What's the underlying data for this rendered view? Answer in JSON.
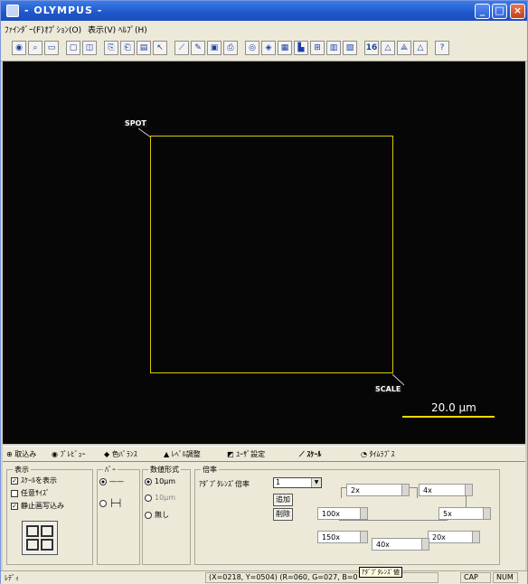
{
  "titlebar": {
    "title": "- OLYMPUS -"
  },
  "menu": [
    "ﾌｧｲﾝﾀﾞｰ(F)",
    "ｵﾌﾟｼｮﾝ(O)",
    "表示(V)",
    "ﾍﾙﾌﾟ(H)"
  ],
  "toolbar": {
    "bits_label": "16"
  },
  "viewer": {
    "spot_label": "SPOT",
    "scale_label": "SCALE",
    "scale_value": "20.0 μm",
    "box_color": "#d8c800",
    "scalebar_color": "#ffd700"
  },
  "tabs": [
    "取込み",
    "ﾌﾟﾚﾋﾞｭｰ",
    "色ﾊﾞﾗﾝｽ",
    "ﾚﾍﾞﾙ調整",
    "ﾕｰｻﾞ設定",
    "ｽｹｰﾙ",
    "ﾀｲﾑﾗﾌﾟｽ"
  ],
  "panel": {
    "display": {
      "title": "表示",
      "items": [
        {
          "label": "ｽｹｰﾙを表示",
          "checked": true
        },
        {
          "label": "任意ｻｲｽﾞ",
          "checked": false
        },
        {
          "label": "静止画写込み",
          "checked": true
        }
      ]
    },
    "bar": {
      "title": "ﾊﾞｰ"
    },
    "numeric": {
      "title": "数値形式",
      "options": [
        "10μm",
        "10μm",
        "無し"
      ]
    },
    "mag": {
      "title": "倍率",
      "objective_label": "ｱﾀﾞﾌﾟﾀﾚﾝｽﾞ倍率",
      "objective_value": "1",
      "add_label": "追加",
      "delete_label": "削除",
      "values": [
        "2x",
        "4x",
        "100x",
        "5x",
        "150x",
        "20x",
        "40x"
      ]
    }
  },
  "tooltip": "ｱﾀﾞﾌﾟﾀﾚﾝｽﾞ値",
  "status": {
    "ready": "ﾚﾃﾞｨ",
    "coords": "(X=0218, Y=0504) (R=060, G=027, B=0",
    "cap": "CAP",
    "num": "NUM"
  }
}
